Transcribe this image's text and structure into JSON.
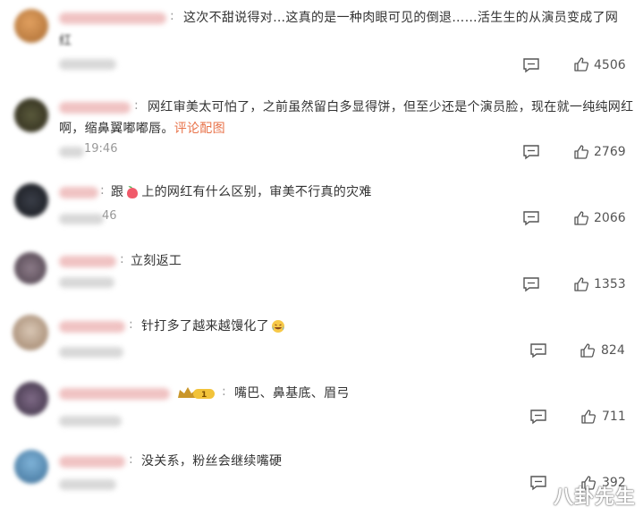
{
  "comments": [
    {
      "text": "这次不甜说得对…这真的是一种肉眼可见的倒退……活生生的从演员变成了网",
      "text2": "红",
      "likes": "4506"
    },
    {
      "text": "网红审美太可怕了，之前虽然留白多显得饼，但至少还是个演员脸，现在就一纯纯网红",
      "text2_prefix": "啊，缩鼻翼嘟嘟唇。",
      "link": "评论配图",
      "time": "19:46",
      "likes": "2769"
    },
    {
      "text_prefix": "跟",
      "text_suffix": "上的网红有什么区别，审美不行真的灾难",
      "time": "46",
      "likes": "2066"
    },
    {
      "text": "立刻返工",
      "likes": "1353"
    },
    {
      "text": "针打多了越来越馒化了",
      "likes": "824"
    },
    {
      "text": "嘴巴、鼻基底、眉弓",
      "likes": "711"
    },
    {
      "text": "没关系，粉丝会继续嘴硬",
      "likes": "392"
    }
  ],
  "separator": ":",
  "watermark": "八卦先生",
  "icons": {
    "reply": "comment-icon",
    "like": "thumbs-up-icon",
    "vip": "crown-badge-icon"
  }
}
